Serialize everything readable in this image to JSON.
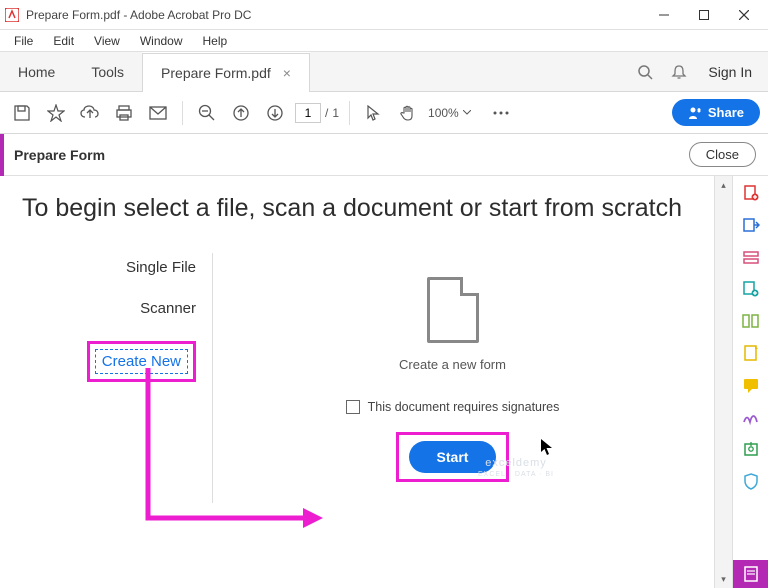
{
  "window": {
    "title": "Prepare Form.pdf - Adobe Acrobat Pro DC"
  },
  "menubar": {
    "items": [
      "File",
      "Edit",
      "View",
      "Window",
      "Help"
    ]
  },
  "tabs": {
    "home": "Home",
    "tools": "Tools",
    "active": "Prepare Form.pdf",
    "signin": "Sign In"
  },
  "toolbar": {
    "page_current": "1",
    "page_total": "1",
    "zoom": "100%",
    "share_label": "Share"
  },
  "context": {
    "title": "Prepare Form",
    "close": "Close"
  },
  "main": {
    "headline": "To begin select a file, scan a document or start from scratch",
    "options": {
      "single_file": "Single File",
      "scanner": "Scanner",
      "create_new": "Create New"
    },
    "center_caption": "Create a new form",
    "signature_label": "This document requires signatures",
    "start": "Start"
  },
  "icons": {
    "app": "acrobat-icon",
    "minimize": "minimize-icon",
    "maximize": "maximize-icon",
    "close": "close-icon",
    "save": "save-icon",
    "star": "star-icon",
    "cloud_up": "cloud-upload-icon",
    "print": "print-icon",
    "mail": "mail-icon",
    "zoom_out": "zoom-out-icon",
    "page_up": "page-up-icon",
    "page_down": "page-down-icon",
    "pointer": "pointer-icon",
    "hand": "hand-icon",
    "more": "more-icon",
    "share_person": "share-person-icon",
    "search": "search-icon",
    "bell": "bell-icon"
  },
  "rail": {
    "items": [
      "create-pdf-icon",
      "export-pdf-icon",
      "edit-pdf-icon",
      "combine-icon",
      "organize-icon",
      "fill-sign-icon",
      "comment-icon",
      "sign-icon",
      "protect-icon",
      "shield-icon"
    ],
    "active": "prepare-form-icon"
  },
  "watermark": {
    "line1": "exceldemy",
    "line2": "EXCEL · DATA · BI"
  }
}
